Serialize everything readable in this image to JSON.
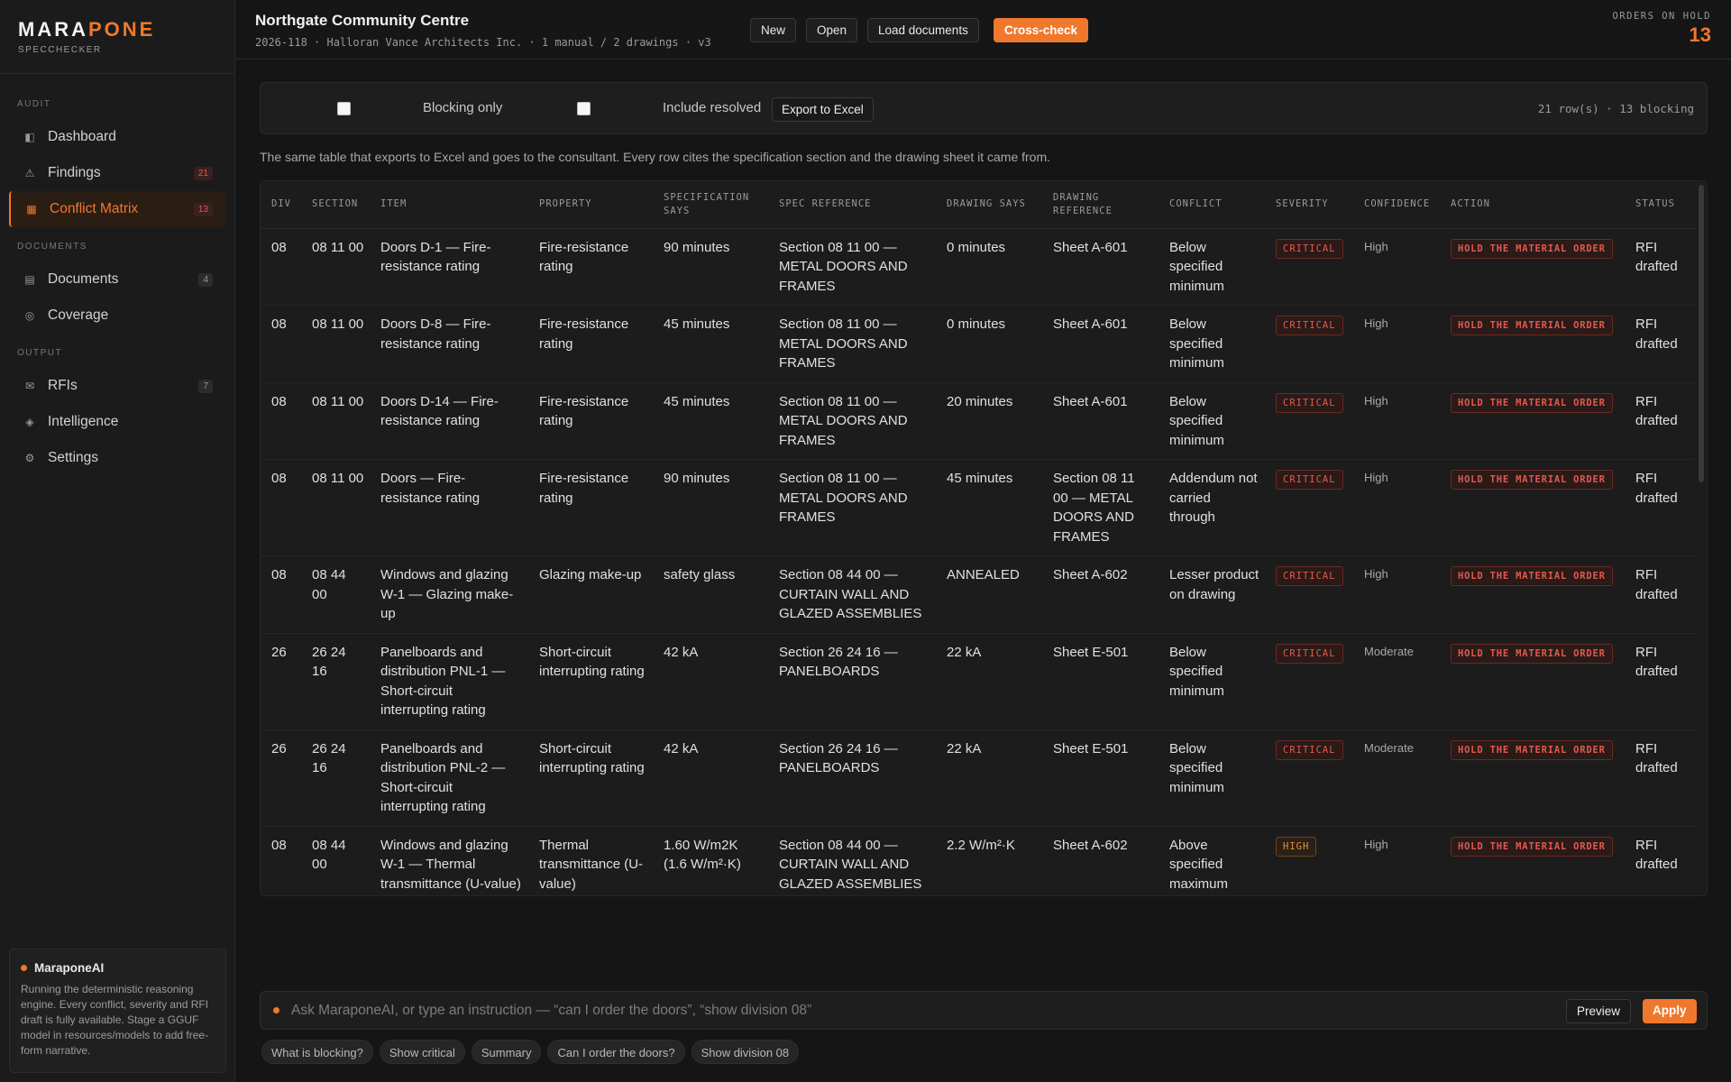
{
  "brand": {
    "name_main": "MARA",
    "name_accent": "PONE",
    "subtitle": "SPECCHECKER"
  },
  "sidebar": {
    "sections": [
      {
        "label": "AUDIT",
        "items": [
          {
            "label": "Dashboard",
            "icon": "dashboard-icon",
            "badge": ""
          },
          {
            "label": "Findings",
            "icon": "warning-icon",
            "badge": "21"
          },
          {
            "label": "Conflict Matrix",
            "icon": "grid-icon",
            "badge": "13",
            "active": true
          }
        ]
      },
      {
        "label": "DOCUMENTS",
        "items": [
          {
            "label": "Documents",
            "icon": "document-icon",
            "badge": "4"
          },
          {
            "label": "Coverage",
            "icon": "coverage-icon",
            "badge": ""
          }
        ]
      },
      {
        "label": "OUTPUT",
        "items": [
          {
            "label": "RFIs",
            "icon": "mail-icon",
            "badge": "7"
          },
          {
            "label": "Intelligence",
            "icon": "diamond-icon",
            "badge": ""
          },
          {
            "label": "Settings",
            "icon": "gear-icon",
            "badge": ""
          }
        ]
      }
    ],
    "ai_card": {
      "title": "MaraponeAI",
      "text": "Running the deterministic reasoning engine. Every conflict, severity and RFI draft is fully available. Stage a GGUF model in resources/models to add free-form narrative."
    }
  },
  "header": {
    "title": "Northgate Community Centre",
    "meta": "2026-118 · Halloran Vance Architects Inc. · 1 manual / 2 drawings · v3",
    "buttons": {
      "new": "New",
      "open": "Open",
      "load": "Load documents",
      "crosscheck": "Cross-check"
    },
    "orders_label": "ORDERS ON HOLD",
    "orders_count": "13"
  },
  "filters": {
    "blocking_only": "Blocking only",
    "include_resolved": "Include resolved",
    "export": "Export to Excel",
    "row_count": "21 row(s) · 13 blocking"
  },
  "description": "The same table that exports to Excel and goes to the consultant. Every row cites the specification section and the drawing sheet it came from.",
  "table": {
    "columns": [
      "DIV",
      "SECTION",
      "ITEM",
      "PROPERTY",
      "SPECIFICATION SAYS",
      "SPEC REFERENCE",
      "DRAWING SAYS",
      "DRAWING REFERENCE",
      "CONFLICT",
      "SEVERITY",
      "CONFIDENCE",
      "ACTION",
      "STATUS"
    ],
    "rows": [
      {
        "div": "08",
        "section": "08 11 00",
        "item": "Doors D-1 — Fire-resistance rating",
        "property": "Fire-resistance rating",
        "spec_says": "90 minutes",
        "spec_ref": "Section 08 11 00 — METAL DOORS AND FRAMES",
        "drawing_says": "0 minutes",
        "drawing_ref": "Sheet A-601",
        "conflict": "Below specified minimum",
        "severity": "CRITICAL",
        "confidence": "High",
        "action": "HOLD THE MATERIAL ORDER",
        "status": "RFI drafted"
      },
      {
        "div": "08",
        "section": "08 11 00",
        "item": "Doors D-8 — Fire-resistance rating",
        "property": "Fire-resistance rating",
        "spec_says": "45 minutes",
        "spec_ref": "Section 08 11 00 — METAL DOORS AND FRAMES",
        "drawing_says": "0 minutes",
        "drawing_ref": "Sheet A-601",
        "conflict": "Below specified minimum",
        "severity": "CRITICAL",
        "confidence": "High",
        "action": "HOLD THE MATERIAL ORDER",
        "status": "RFI drafted"
      },
      {
        "div": "08",
        "section": "08 11 00",
        "item": "Doors D-14 — Fire-resistance rating",
        "property": "Fire-resistance rating",
        "spec_says": "45 minutes",
        "spec_ref": "Section 08 11 00 — METAL DOORS AND FRAMES",
        "drawing_says": "20 minutes",
        "drawing_ref": "Sheet A-601",
        "conflict": "Below specified minimum",
        "severity": "CRITICAL",
        "confidence": "High",
        "action": "HOLD THE MATERIAL ORDER",
        "status": "RFI drafted"
      },
      {
        "div": "08",
        "section": "08 11 00",
        "item": "Doors — Fire-resistance rating",
        "property": "Fire-resistance rating",
        "spec_says": "90 minutes",
        "spec_ref": "Section 08 11 00 — METAL DOORS AND FRAMES",
        "drawing_says": "45 minutes",
        "drawing_ref": "Section 08 11 00 — METAL DOORS AND FRAMES",
        "conflict": "Addendum not carried through",
        "severity": "CRITICAL",
        "confidence": "High",
        "action": "HOLD THE MATERIAL ORDER",
        "status": "RFI drafted"
      },
      {
        "div": "08",
        "section": "08 44 00",
        "item": "Windows and glazing W-1 — Glazing make-up",
        "property": "Glazing make-up",
        "spec_says": "safety glass",
        "spec_ref": "Section 08 44 00 — CURTAIN WALL AND GLAZED ASSEMBLIES",
        "drawing_says": "ANNEALED",
        "drawing_ref": "Sheet A-602",
        "conflict": "Lesser product on drawing",
        "severity": "CRITICAL",
        "confidence": "High",
        "action": "HOLD THE MATERIAL ORDER",
        "status": "RFI drafted"
      },
      {
        "div": "26",
        "section": "26 24 16",
        "item": "Panelboards and distribution PNL-1 — Short-circuit interrupting rating",
        "property": "Short-circuit interrupting rating",
        "spec_says": "42 kA",
        "spec_ref": "Section 26 24 16 — PANELBOARDS",
        "drawing_says": "22 kA",
        "drawing_ref": "Sheet E-501",
        "conflict": "Below specified minimum",
        "severity": "CRITICAL",
        "confidence": "Moderate",
        "action": "HOLD THE MATERIAL ORDER",
        "status": "RFI drafted"
      },
      {
        "div": "26",
        "section": "26 24 16",
        "item": "Panelboards and distribution PNL-2 — Short-circuit interrupting rating",
        "property": "Short-circuit interrupting rating",
        "spec_says": "42 kA",
        "spec_ref": "Section 26 24 16 — PANELBOARDS",
        "drawing_says": "22 kA",
        "drawing_ref": "Sheet E-501",
        "conflict": "Below specified minimum",
        "severity": "CRITICAL",
        "confidence": "Moderate",
        "action": "HOLD THE MATERIAL ORDER",
        "status": "RFI drafted"
      },
      {
        "div": "08",
        "section": "08 44 00",
        "item": "Windows and glazing W-1 — Thermal transmittance (U-value)",
        "property": "Thermal transmittance (U-value)",
        "spec_says": "1.60 W/m2K (1.6 W/m²·K)",
        "spec_ref": "Section 08 44 00 — CURTAIN WALL AND GLAZED ASSEMBLIES",
        "drawing_says": "2.2 W/m²·K",
        "drawing_ref": "Sheet A-602",
        "conflict": "Above specified maximum",
        "severity": "HIGH",
        "confidence": "High",
        "action": "HOLD THE MATERIAL ORDER",
        "status": "RFI drafted"
      }
    ]
  },
  "ask": {
    "placeholder": "Ask MaraponeAI, or type an instruction — “can I order the doors”, “show division 08”",
    "preview": "Preview",
    "apply": "Apply",
    "chips": [
      "What is blocking?",
      "Show critical",
      "Summary",
      "Can I order the doors?",
      "Show division 08"
    ]
  },
  "colors": {
    "accent": "#f0782c",
    "critical": "#e05a4d",
    "high": "#e8923c"
  }
}
